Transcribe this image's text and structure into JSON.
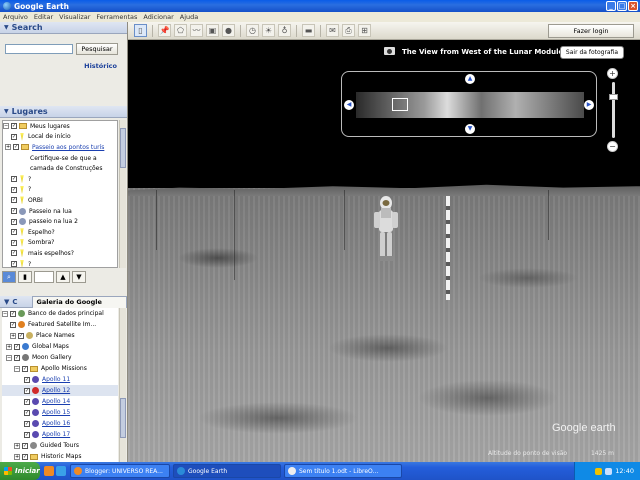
{
  "window": {
    "title": "Google Earth"
  },
  "menu": [
    "Arquivo",
    "Editar",
    "Visualizar",
    "Ferramentas",
    "Adicionar",
    "Ajuda"
  ],
  "toolbar": {
    "icons": [
      "sidebar-toggle-icon",
      "placemark-icon",
      "polygon-icon",
      "path-icon",
      "image-overlay-icon",
      "tour-icon",
      "historical-imagery-icon",
      "sunlight-icon",
      "planets-icon",
      "ruler-icon",
      "email-icon",
      "print-icon",
      "maps-icon"
    ],
    "login_label": "Fazer login"
  },
  "search": {
    "title": "Search",
    "button_label": "Pesquisar",
    "history_label": "Histórico",
    "input_value": ""
  },
  "places": {
    "title": "Lugares",
    "items": [
      {
        "label": "Meus lugares",
        "link": false
      },
      {
        "label": "Local de início",
        "link": false
      },
      {
        "label": "Passeio aos pontos turís",
        "link": true
      },
      {
        "label": "Certifique-se de que a",
        "link": false
      },
      {
        "label": "camada de Construções",
        "link": false
      },
      {
        "label": "?",
        "link": false
      },
      {
        "label": "?",
        "link": false
      },
      {
        "label": "ORBI",
        "link": false
      },
      {
        "label": "Passeio na lua",
        "link": false
      },
      {
        "label": "passeio na lua 2",
        "link": false
      },
      {
        "label": "Espelho?",
        "link": false
      },
      {
        "label": "Sombra?",
        "link": false
      },
      {
        "label": "mais espelhos?",
        "link": false
      },
      {
        "label": "?",
        "link": false
      },
      {
        "label": "?",
        "link": false
      }
    ]
  },
  "layers": {
    "title": "C",
    "tab_label": "Galeria do Google Earth",
    "items": [
      {
        "label": "Banco de dados principal",
        "link": false
      },
      {
        "label": "Featured Satellite Im...",
        "link": false
      },
      {
        "label": "Place Names",
        "link": false
      },
      {
        "label": "Global Maps",
        "link": false
      },
      {
        "label": "Moon Gallery",
        "link": false
      },
      {
        "label": "Apollo Missions",
        "link": false
      },
      {
        "label": "Apollo 11",
        "link": true
      },
      {
        "label": "Apollo 12",
        "link": true
      },
      {
        "label": "Apollo 14",
        "link": true
      },
      {
        "label": "Apollo 15",
        "link": true
      },
      {
        "label": "Apollo 16",
        "link": true
      },
      {
        "label": "Apollo 17",
        "link": true
      },
      {
        "label": "Guided Tours",
        "link": false
      },
      {
        "label": "Historic Maps",
        "link": false
      }
    ]
  },
  "viewer": {
    "photo_title": "The View from West of the Lunar Module",
    "exit_label": "Sair da fotografia",
    "logo": "Google earth",
    "altitude_label": "Altitude do ponto de visão",
    "altitude_value": "1425 m"
  },
  "taskbar": {
    "start_label": "Iniciar",
    "tasks": [
      "Blogger: UNIVERSO REA...",
      "Google Earth",
      "Sem título 1.odt - LibreO..."
    ],
    "clock": "12:40"
  },
  "colors": {
    "titlebar": "#245edb",
    "link": "#1a3fb0",
    "panel_header": "#2a4a88"
  }
}
